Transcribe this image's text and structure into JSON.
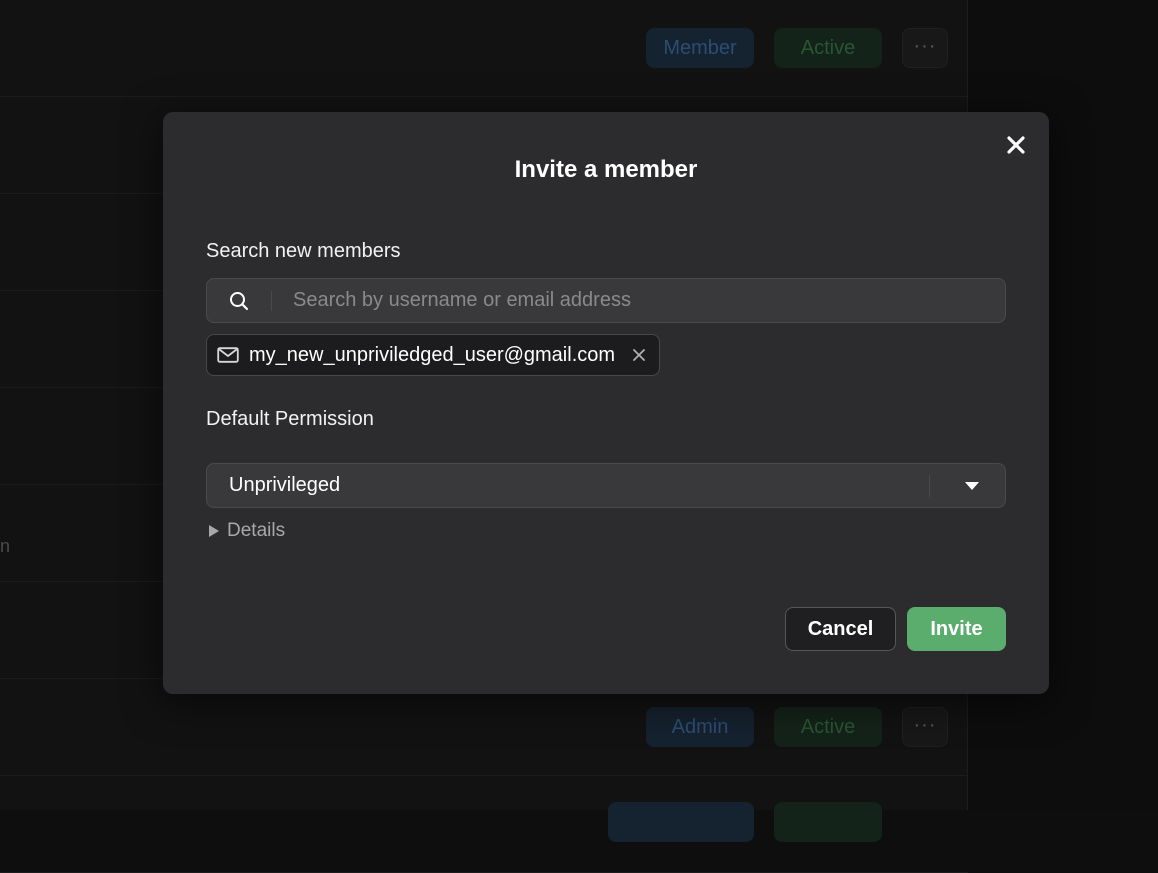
{
  "background": {
    "rows": [
      {
        "role": "Member",
        "status": "Active"
      },
      {
        "role": "Admin",
        "status": "Active"
      }
    ],
    "more_label": "···",
    "stub_text": "n"
  },
  "modal": {
    "title": "Invite a member",
    "search_section_label": "Search new members",
    "search_placeholder": "Search by username or email address",
    "search_value": "",
    "selected_chips": [
      {
        "icon": "mail-icon",
        "label": "my_new_unpriviledged_user@gmail.com"
      }
    ],
    "permission_section_label": "Default Permission",
    "permission_selected": "Unprivileged",
    "details_label": "Details",
    "cancel_label": "Cancel",
    "invite_label": "Invite"
  },
  "colors": {
    "accent_green": "#5aad6d",
    "modal_bg": "#2c2c2e",
    "input_bg": "#39393c"
  }
}
